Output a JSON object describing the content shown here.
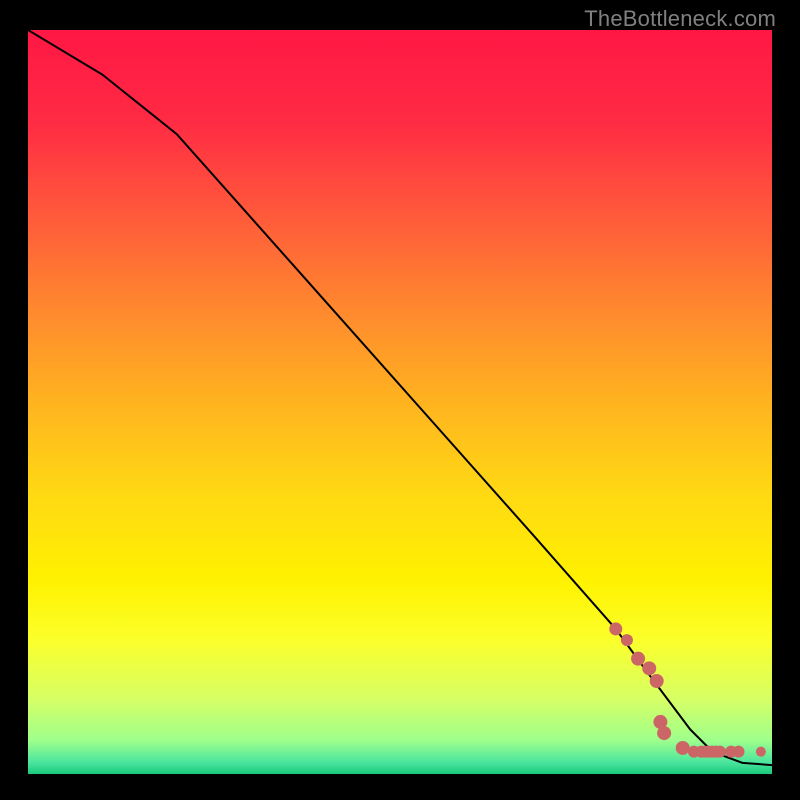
{
  "watermark": "TheBottleneck.com",
  "colors": {
    "gradient_stops": [
      {
        "offset": 0.0,
        "color": "#ff1744"
      },
      {
        "offset": 0.12,
        "color": "#ff2a44"
      },
      {
        "offset": 0.25,
        "color": "#ff5a3a"
      },
      {
        "offset": 0.38,
        "color": "#ff8a2e"
      },
      {
        "offset": 0.5,
        "color": "#ffb31f"
      },
      {
        "offset": 0.62,
        "color": "#ffd814"
      },
      {
        "offset": 0.74,
        "color": "#fff200"
      },
      {
        "offset": 0.82,
        "color": "#fbff2a"
      },
      {
        "offset": 0.9,
        "color": "#d6ff66"
      },
      {
        "offset": 0.955,
        "color": "#9eff8c"
      },
      {
        "offset": 0.985,
        "color": "#49e49e"
      },
      {
        "offset": 1.0,
        "color": "#19c97a"
      }
    ],
    "curve": "#000000",
    "markers": "#cc6666"
  },
  "chart_data": {
    "type": "line",
    "title": "",
    "xlabel": "",
    "ylabel": "",
    "xlim": [
      0,
      100
    ],
    "ylim": [
      0,
      100
    ],
    "series": [
      {
        "name": "curve",
        "x": [
          0,
          10,
          20,
          36,
          52,
          68,
          79,
          83,
          86,
          89,
          92,
          96,
          100
        ],
        "y": [
          100,
          94,
          86,
          68,
          50,
          32,
          19.5,
          14,
          10,
          6,
          3,
          1.5,
          1.2
        ],
        "style": "line",
        "color": "#000000"
      },
      {
        "name": "markers",
        "x": [
          79,
          80.5,
          82,
          83.5,
          84.5,
          85,
          85.5,
          88,
          89.5,
          90.5,
          91,
          91.5,
          92,
          92.5,
          93,
          94.5,
          95.5,
          98.5
        ],
        "y": [
          19.5,
          18,
          15.5,
          14.2,
          12.5,
          7,
          5.5,
          3.5,
          3,
          3,
          3,
          3,
          3,
          3,
          3,
          3,
          3,
          3
        ],
        "style": "scatter",
        "marker_size": [
          6.5,
          6,
          7,
          7,
          7,
          7,
          7,
          7,
          6,
          6,
          6,
          6,
          6,
          6,
          6,
          6,
          6,
          5
        ],
        "color": "#cc6666"
      }
    ]
  }
}
